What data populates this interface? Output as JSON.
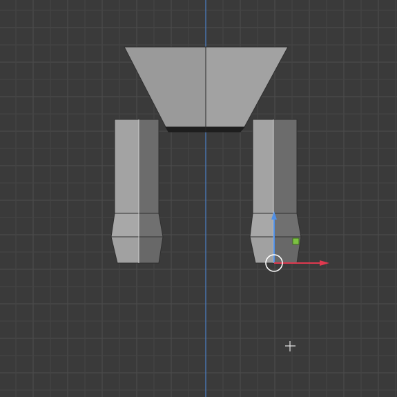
{
  "viewport": {
    "background": "#3a3a3a",
    "grid_minor_color": "#454545",
    "grid_major_color": "#4d4d4d",
    "axis_y_color": "#4a7fc7"
  },
  "mesh": {
    "face_light": "#9c9c9c",
    "face_mid": "#8a8a8a",
    "face_dark": "#6b6b6b",
    "edge_color": "#2a2a2a",
    "highlight_edge": "#cfcfcf"
  },
  "gizmo": {
    "x_arrow_color": "#e0394f",
    "z_arrow_color": "#4f8fe6",
    "pivot_ring_color": "#ffffff",
    "handle_color": "#7cc142"
  },
  "cursor": {
    "icon": "crosshair-icon"
  }
}
